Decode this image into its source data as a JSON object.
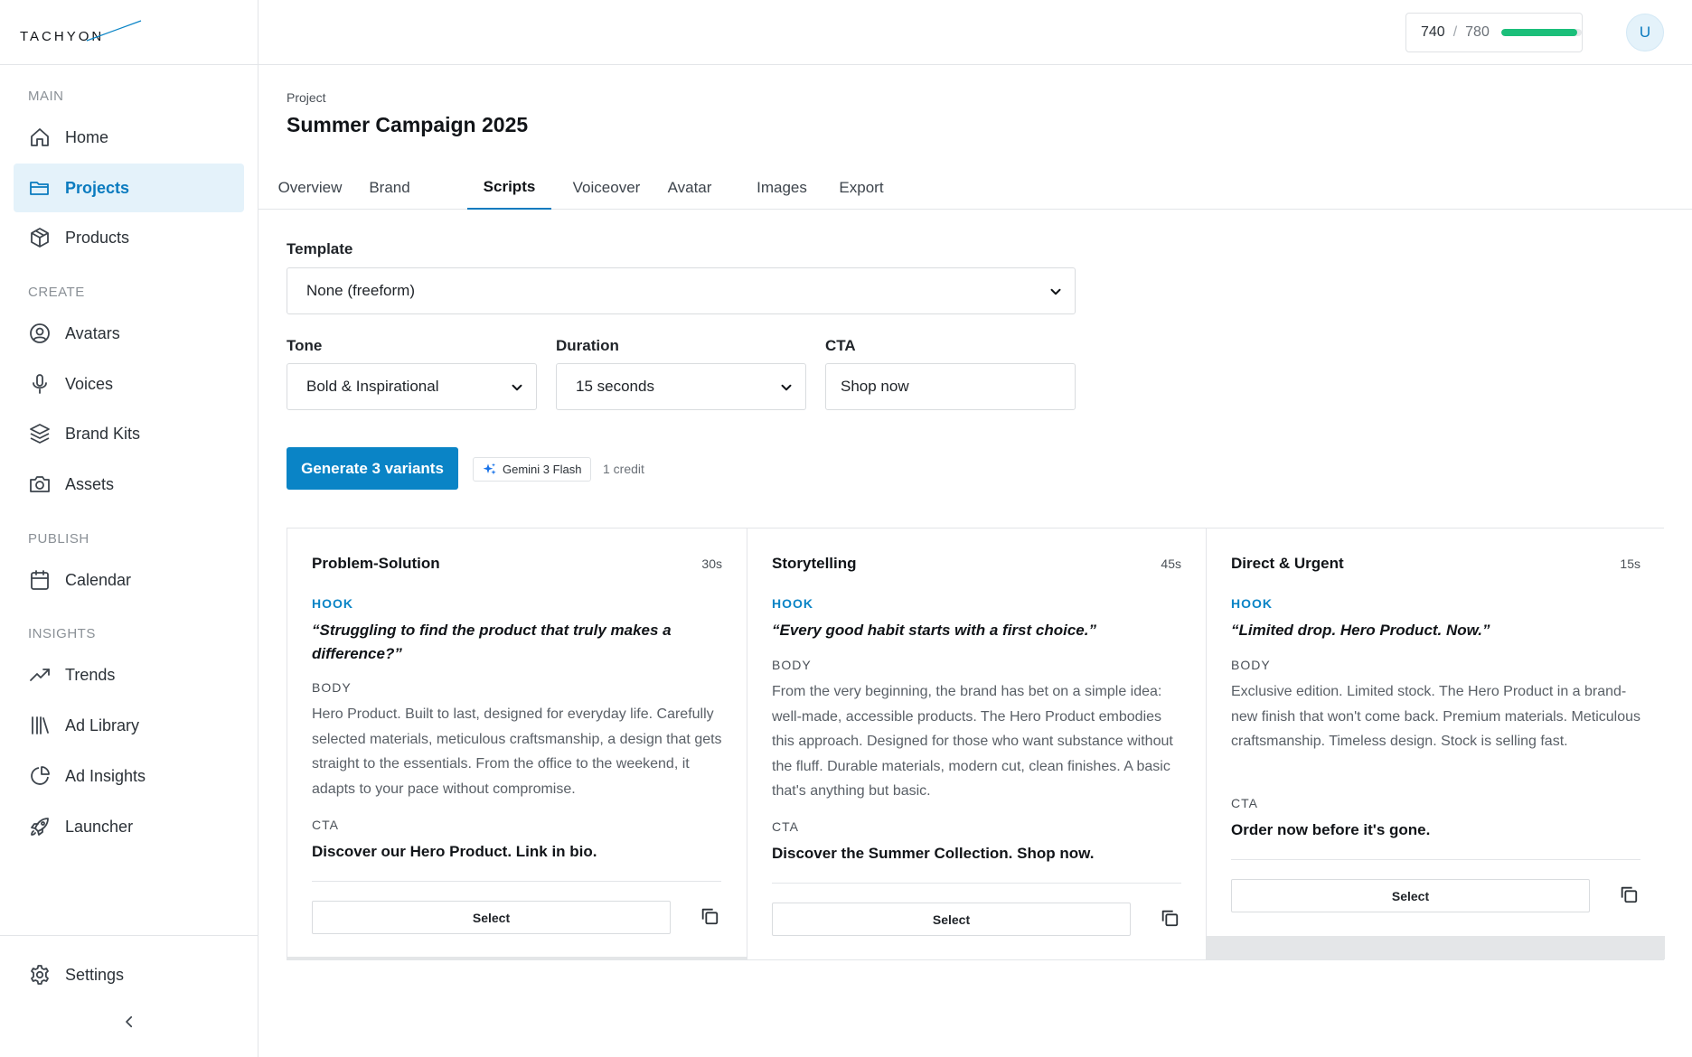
{
  "brand": {
    "logo_text": "TACHYON"
  },
  "sidebar": {
    "sections": [
      {
        "label": "MAIN"
      },
      {
        "label": "CREATE"
      },
      {
        "label": "PUBLISH"
      },
      {
        "label": "INSIGHTS"
      }
    ],
    "items": [
      {
        "label": "Home",
        "icon": "home-icon"
      },
      {
        "label": "Projects",
        "icon": "folder-icon",
        "active": true
      },
      {
        "label": "Products",
        "icon": "box-icon"
      },
      {
        "label": "Avatars",
        "icon": "user-circle-icon"
      },
      {
        "label": "Voices",
        "icon": "microphone-icon"
      },
      {
        "label": "Brand Kits",
        "icon": "layers-icon"
      },
      {
        "label": "Assets",
        "icon": "camera-icon"
      },
      {
        "label": "Calendar",
        "icon": "calendar-icon"
      },
      {
        "label": "Trends",
        "icon": "trending-up-icon"
      },
      {
        "label": "Ad Library",
        "icon": "library-icon"
      },
      {
        "label": "Ad Insights",
        "icon": "pie-chart-icon"
      },
      {
        "label": "Launcher",
        "icon": "rocket-icon"
      }
    ],
    "settings_label": "Settings",
    "collapse_icon": "chevron-left-icon"
  },
  "header": {
    "credits_used": "740",
    "credits_sep": "/",
    "credits_total": "780",
    "credits_fraction": 0.949,
    "avatar_initial": "U"
  },
  "project": {
    "breadcrumb": "Project",
    "title": "Summer Campaign 2025"
  },
  "tabs": [
    {
      "label": "Overview"
    },
    {
      "label": "Brand"
    },
    {
      "label": "Scripts",
      "active": true
    },
    {
      "label": "Voiceover"
    },
    {
      "label": "Avatar"
    },
    {
      "label": "Images"
    },
    {
      "label": "Export"
    }
  ],
  "form": {
    "template_label": "Template",
    "template_value": "None (freeform)",
    "tone_label": "Tone",
    "tone_value": "Bold & Inspirational",
    "duration_label": "Duration",
    "duration_value": "15 seconds",
    "cta_label": "CTA",
    "cta_value": "Shop now"
  },
  "generate": {
    "button_label": "Generate 3 variants",
    "model_label": "Gemini 3 Flash",
    "credit_note": "1 credit"
  },
  "cards": [
    {
      "title": "Problem-Solution",
      "duration": "30s",
      "hook_label": "HOOK",
      "hook": "“Struggling to find the product that truly makes a difference?”",
      "body_label": "BODY",
      "body": "Hero Product. Built to last, designed for everyday life. Carefully selected materials, meticulous craftsmanship, a design that gets straight to the essentials. From the office to the weekend, it adapts to your pace without compromise.",
      "cta_label": "CTA",
      "cta": "Discover our Hero Product. Link in bio.",
      "select_label": "Select"
    },
    {
      "title": "Storytelling",
      "duration": "45s",
      "hook_label": "HOOK",
      "hook": "“Every good habit starts with a first choice.”",
      "body_label": "BODY",
      "body": "From the very beginning, the brand has bet on a simple idea: well-made, accessible products. The Hero Product embodies this approach. Designed for those who want substance without the fluff. Durable materials, modern cut, clean finishes. A basic that's anything but basic.",
      "cta_label": "CTA",
      "cta": "Discover the Summer Collection. Shop now.",
      "select_label": "Select"
    },
    {
      "title": "Direct & Urgent",
      "duration": "15s",
      "hook_label": "HOOK",
      "hook": "“Limited drop. Hero Product. Now.”",
      "body_label": "BODY",
      "body": "Exclusive edition. Limited stock. The Hero Product in a brand-new finish that won't come back. Premium materials. Meticulous craftsmanship. Timeless design. Stock is selling fast.",
      "cta_label": "CTA",
      "cta": "Order now before it's gone.",
      "select_label": "Select"
    }
  ]
}
